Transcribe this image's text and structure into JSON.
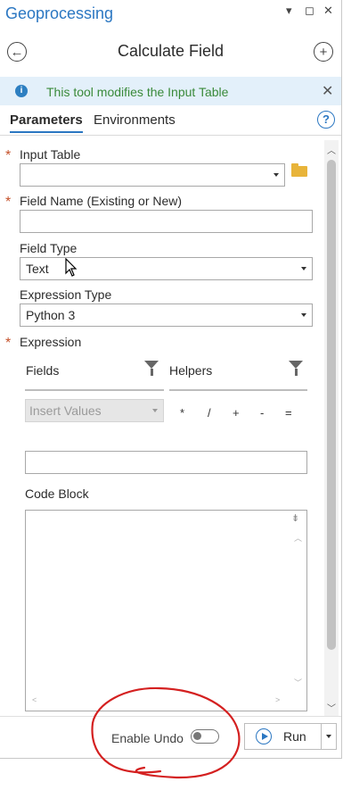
{
  "pane": {
    "title": "Geoprocessing",
    "controls": [
      "▾",
      "◻",
      "✕"
    ]
  },
  "tool": {
    "title": "Calculate Field",
    "back_icon": "back-arrow-icon",
    "add_icon": "add-icon"
  },
  "info": {
    "message": "This tool modifies the Input Table",
    "icon": "info-icon"
  },
  "tabs": [
    {
      "label": "Parameters",
      "active": true
    },
    {
      "label": "Environments",
      "active": false
    }
  ],
  "params": {
    "input_table": {
      "label": "Input Table",
      "required": true,
      "value": ""
    },
    "field_name": {
      "label": "Field Name (Existing or New)",
      "required": true,
      "value": ""
    },
    "field_type": {
      "label": "Field Type",
      "value": "Text"
    },
    "expression_type": {
      "label": "Expression Type",
      "value": "Python 3"
    },
    "expression": {
      "label": "Expression",
      "required": true
    }
  },
  "expression_builder": {
    "fields_label": "Fields",
    "helpers_label": "Helpers",
    "insert_values": "Insert Values",
    "operators": [
      "*",
      "/",
      "+",
      "-",
      "="
    ],
    "expression_value": ""
  },
  "code_block": {
    "label": "Code Block",
    "value": ""
  },
  "footer": {
    "enable_undo_label": "Enable Undo",
    "enable_undo_on": false,
    "run_label": "Run"
  },
  "colors": {
    "accent": "#2b77c2",
    "info_bg": "#e3f0fa",
    "info_text": "#3a8a3a",
    "required": "#c5522b",
    "annotation": "#d42020"
  }
}
